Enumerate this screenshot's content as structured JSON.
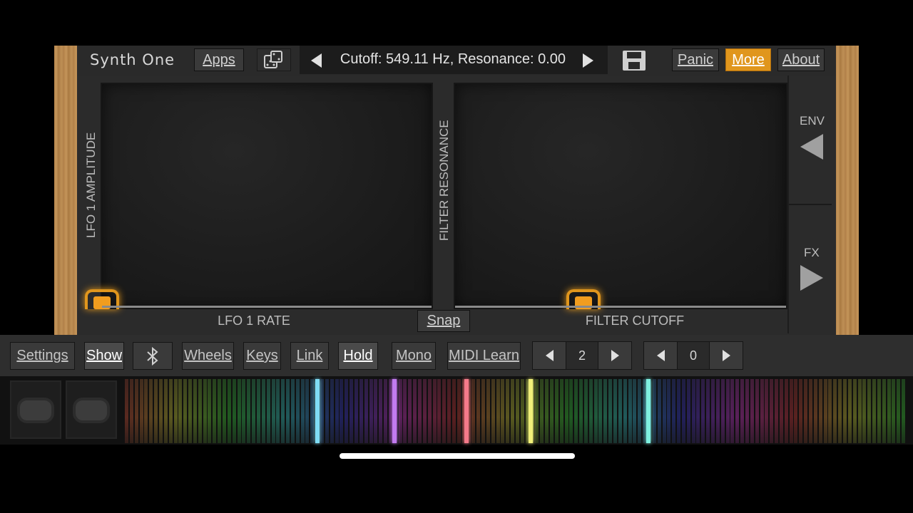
{
  "header": {
    "brand": "Synth One",
    "apps_label": "Apps",
    "dice_icon": "dice-icon",
    "preset_display": "Cutoff: 549.11 Hz, Resonance: 0.00",
    "save_icon": "save-icon",
    "panic_label": "Panic",
    "more_label": "More",
    "about_label": "About"
  },
  "pads": {
    "left": {
      "y_label": "LFO 1 AMPLITUDE",
      "x_label": "LFO 1 RATE"
    },
    "right": {
      "y_label": "FILTER RESONANCE",
      "x_label": "FILTER CUTOFF"
    },
    "snap_label": "Snap"
  },
  "side": {
    "env_label": "ENV",
    "fx_label": "FX"
  },
  "toolbar": {
    "settings_label": "Settings",
    "show_label": "Show",
    "bluetooth_icon": "bluetooth-icon",
    "wheels_label": "Wheels",
    "keys_label": "Keys",
    "link_label": "Link",
    "hold_label": "Hold",
    "mono_label": "Mono",
    "midi_learn_label": "MIDI Learn",
    "octave_value": "2",
    "transpose_value": "0"
  },
  "colors": {
    "accent": "#e0961d",
    "key_highlights": [
      "#7fdcf5",
      "#c27bf0",
      "#f57a8a",
      "#f2f07a",
      "#7ff0e0"
    ]
  }
}
